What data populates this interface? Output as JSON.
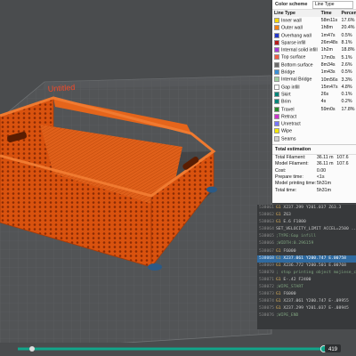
{
  "plate": {
    "name": "Untitled"
  },
  "legend": {
    "title": "Color scheme",
    "view_type": "Line Type",
    "col_type": "Line Type",
    "col_time": "Time",
    "col_percent": "Percent",
    "items": [
      {
        "name": "Inner wall",
        "time": "58m11s",
        "pct": "17.6%",
        "color": "#f4d600"
      },
      {
        "name": "Outer wall",
        "time": "1h8m",
        "pct": "20.4%",
        "color": "#f57f17"
      },
      {
        "name": "Overhang wall",
        "time": "1m47s",
        "pct": "0.5%",
        "color": "#2537c9"
      },
      {
        "name": "Sparse infill",
        "time": "26m48s",
        "pct": "8.1%",
        "color": "#b71c1c"
      },
      {
        "name": "Internal solid infill",
        "time": "1h2m",
        "pct": "18.8%",
        "color": "#a53cd8"
      },
      {
        "name": "Top surface",
        "time": "17m0s",
        "pct": "5.1%",
        "color": "#f25c45"
      },
      {
        "name": "Bottom surface",
        "time": "8m34s",
        "pct": "2.6%",
        "color": "#6b6b6b"
      },
      {
        "name": "Bridge",
        "time": "1m43s",
        "pct": "0.5%",
        "color": "#3b8fd6"
      },
      {
        "name": "Internal Bridge",
        "time": "10m56s",
        "pct": "3.3%",
        "color": "#a0d0a0"
      },
      {
        "name": "Gap infill",
        "time": "15m47s",
        "pct": "4.8%",
        "color": "#ffffff"
      },
      {
        "name": "Skirt",
        "time": "26s",
        "pct": "0.1%",
        "color": "#00857a"
      },
      {
        "name": "Brim",
        "time": "4s",
        "pct": "0.2%",
        "color": "#00857a"
      },
      {
        "name": "Travel",
        "time": "59m0s",
        "pct": "17.8%",
        "color": "#2a8c2a"
      },
      {
        "name": "Retract",
        "time": "",
        "pct": "",
        "color": "#cc33cc"
      },
      {
        "name": "Unretract",
        "time": "",
        "pct": "",
        "color": "#7777ff"
      },
      {
        "name": "Wipe",
        "time": "",
        "pct": "",
        "color": "#f4e800"
      },
      {
        "name": "Seams",
        "time": "",
        "pct": "",
        "color": "#d0d0d0"
      }
    ],
    "estimation_title": "Total estimation",
    "estimation": [
      {
        "k": "Total Filament:",
        "v": "36.11 m",
        "w": "107.6"
      },
      {
        "k": "Model Filament:",
        "v": "36.11 m",
        "w": "107.6"
      },
      {
        "k": "Cost:",
        "v": "0.00",
        "w": ""
      },
      {
        "k": "Prepare time:",
        "v": "<1s",
        "w": ""
      },
      {
        "k": "Model printing time:",
        "v": "5h31m",
        "w": ""
      },
      {
        "k": "Total time:",
        "v": "5h31m",
        "w": ""
      }
    ]
  },
  "gcode": [
    {
      "no": "538061",
      "cmd": "G1",
      "text": " X237.299 Y201.037 Z63.3"
    },
    {
      "no": "538062",
      "cmd": "G1",
      "text": " Z63"
    },
    {
      "no": "538063",
      "cmd": "G1",
      "text": " E.6 F1800"
    },
    {
      "no": "538064",
      "cmd": "",
      "text": "SET_VELOCITY_LIMIT ACCEL=2500 ..."
    },
    {
      "no": "538065",
      "cmd": "",
      "text": ";TYPE:Gap infill",
      "comment": true
    },
    {
      "no": "538066",
      "cmd": "",
      "text": ";WIDTH:0.296159",
      "comment": true
    },
    {
      "no": "538067",
      "cmd": "G1",
      "text": " F6000"
    },
    {
      "no": "538068",
      "cmd": "G1",
      "text": " X237.061 Y200.747 E.00758",
      "current": true
    },
    {
      "no": "538069",
      "cmd": "G1",
      "text": " X236.772 Y200.501 E.00768"
    },
    {
      "no": "538070",
      "cmd": "",
      "text": "; stop printing object mojiese_crate_...",
      "comment": true
    },
    {
      "no": "538071",
      "cmd": "G1",
      "text": " E-.42 F2400"
    },
    {
      "no": "538072",
      "cmd": "",
      "text": ";WIPE_START",
      "comment": true
    },
    {
      "no": "538073",
      "cmd": "G1",
      "text": " F6000"
    },
    {
      "no": "538074",
      "cmd": "G1",
      "text": " X237.061 Y200.747 E-.09955"
    },
    {
      "no": "538075",
      "cmd": "G1",
      "text": " X237.299 Y201.037 E-.08945"
    },
    {
      "no": "538076",
      "cmd": "",
      "text": ";WIPE_END",
      "comment": true
    }
  ],
  "slider": {
    "layer": "419",
    "fraction": 0.955
  }
}
